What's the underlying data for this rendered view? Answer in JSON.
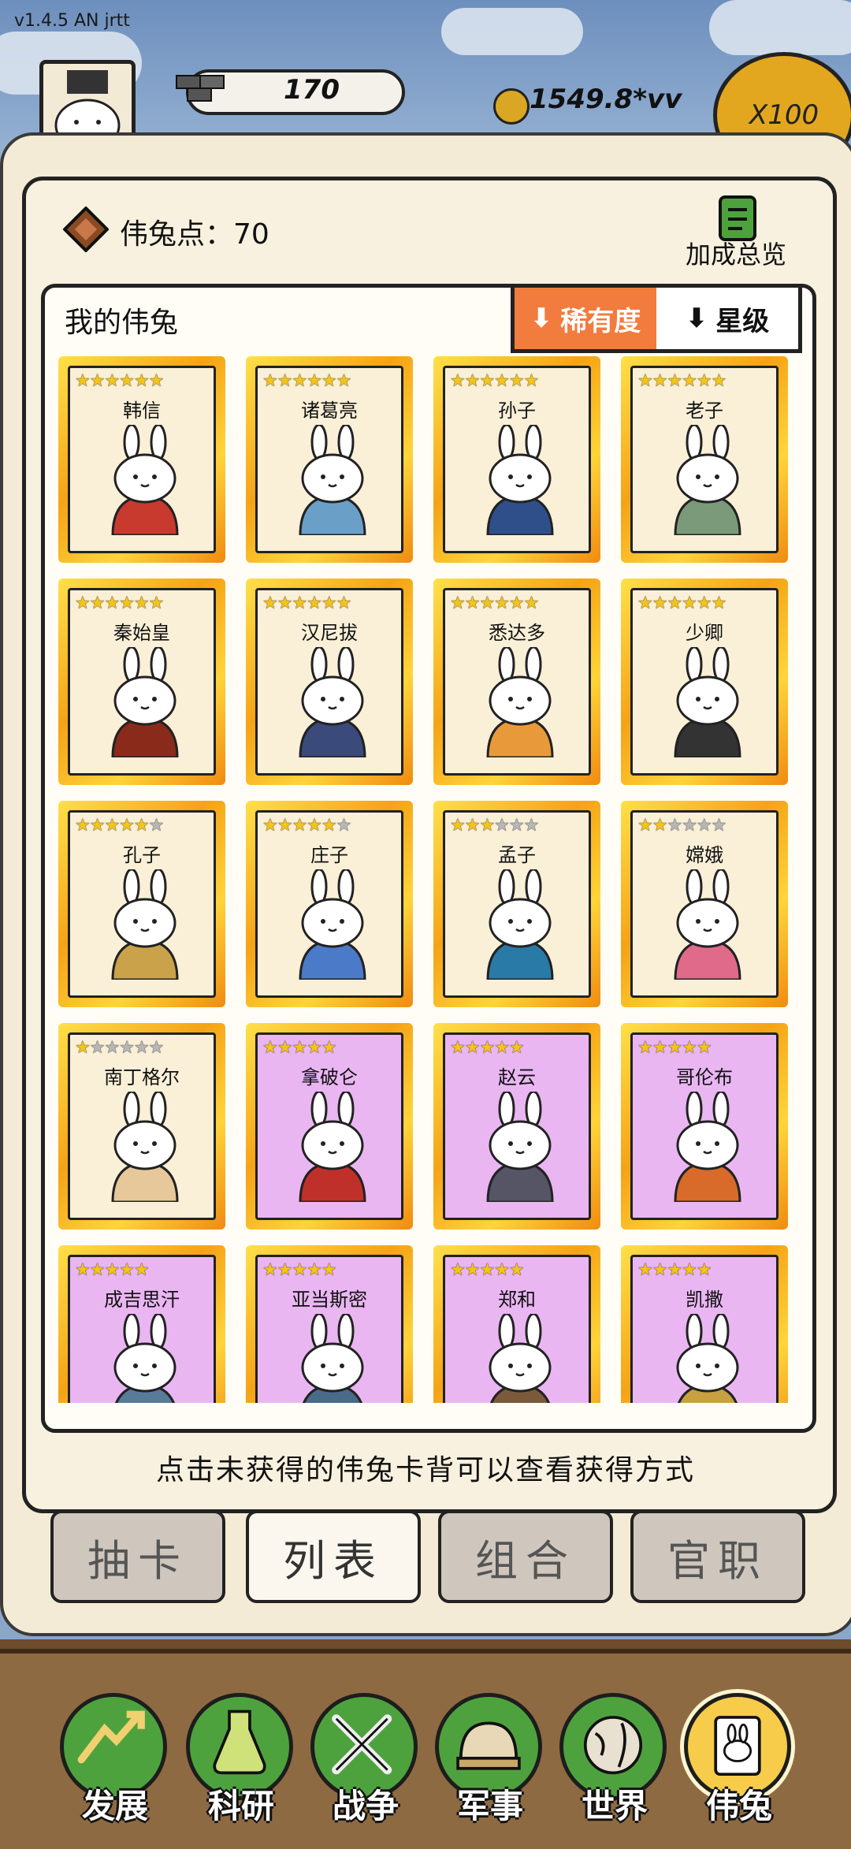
{
  "app": {
    "version": "v1.4.5 AN jrtt"
  },
  "hud": {
    "resource_value": "170",
    "coins": "1549.8*vv",
    "multiplier": "X100"
  },
  "panel": {
    "points_label": "伟兔点：",
    "points_value": "70",
    "bonus_label": "加成总览",
    "list_title": "我的伟兔",
    "sort": {
      "rarity": "稀有度",
      "star": "星级"
    },
    "hint": "点击未获得的伟兔卡背可以查看获得方式"
  },
  "cards": [
    {
      "name": "韩信",
      "stars": 6,
      "max": 6,
      "frame": "gold"
    },
    {
      "name": "诸葛亮",
      "stars": 6,
      "max": 6,
      "frame": "gold"
    },
    {
      "name": "孙子",
      "stars": 6,
      "max": 6,
      "frame": "gold"
    },
    {
      "name": "老子",
      "stars": 6,
      "max": 6,
      "frame": "gold"
    },
    {
      "name": "秦始皇",
      "stars": 6,
      "max": 6,
      "frame": "gold"
    },
    {
      "name": "汉尼拔",
      "stars": 6,
      "max": 6,
      "frame": "gold"
    },
    {
      "name": "悉达多",
      "stars": 6,
      "max": 6,
      "frame": "gold"
    },
    {
      "name": "少卿",
      "stars": 6,
      "max": 6,
      "frame": "gold"
    },
    {
      "name": "孔子",
      "stars": 5,
      "max": 6,
      "frame": "gold"
    },
    {
      "name": "庄子",
      "stars": 5,
      "max": 6,
      "frame": "gold"
    },
    {
      "name": "孟子",
      "stars": 3,
      "max": 6,
      "frame": "gold"
    },
    {
      "name": "嫦娥",
      "stars": 2,
      "max": 6,
      "frame": "gold"
    },
    {
      "name": "南丁格尔",
      "stars": 1,
      "max": 6,
      "frame": "gold"
    },
    {
      "name": "拿破仑",
      "stars": 5,
      "max": 5,
      "frame": "purple"
    },
    {
      "name": "赵云",
      "stars": 5,
      "max": 5,
      "frame": "purple"
    },
    {
      "name": "哥伦布",
      "stars": 5,
      "max": 5,
      "frame": "purple"
    },
    {
      "name": "成吉思汗",
      "stars": 5,
      "max": 5,
      "frame": "purple"
    },
    {
      "name": "亚当斯密",
      "stars": 5,
      "max": 5,
      "frame": "purple"
    },
    {
      "name": "郑和",
      "stars": 5,
      "max": 5,
      "frame": "purple"
    },
    {
      "name": "凯撒",
      "stars": 5,
      "max": 5,
      "frame": "purple"
    }
  ],
  "tabs": [
    {
      "label": "抽卡",
      "active": false
    },
    {
      "label": "列表",
      "active": true
    },
    {
      "label": "组合",
      "active": false
    },
    {
      "label": "官职",
      "active": false
    }
  ],
  "nav": [
    {
      "label": "发展",
      "icon": "growth-arrow-icon",
      "active": false
    },
    {
      "label": "科研",
      "icon": "flask-icon",
      "active": false
    },
    {
      "label": "战争",
      "icon": "crossed-swords-icon",
      "active": false
    },
    {
      "label": "军事",
      "icon": "helmet-icon",
      "active": false
    },
    {
      "label": "世界",
      "icon": "globe-icon",
      "active": false
    },
    {
      "label": "伟兔",
      "icon": "bunny-card-icon",
      "active": true
    }
  ],
  "colors": {
    "sort_active": "#f27b3e",
    "nav_green": "#4ea23e",
    "nav_active": "#f6cc4a",
    "card_purple": "#e9b6f2"
  }
}
